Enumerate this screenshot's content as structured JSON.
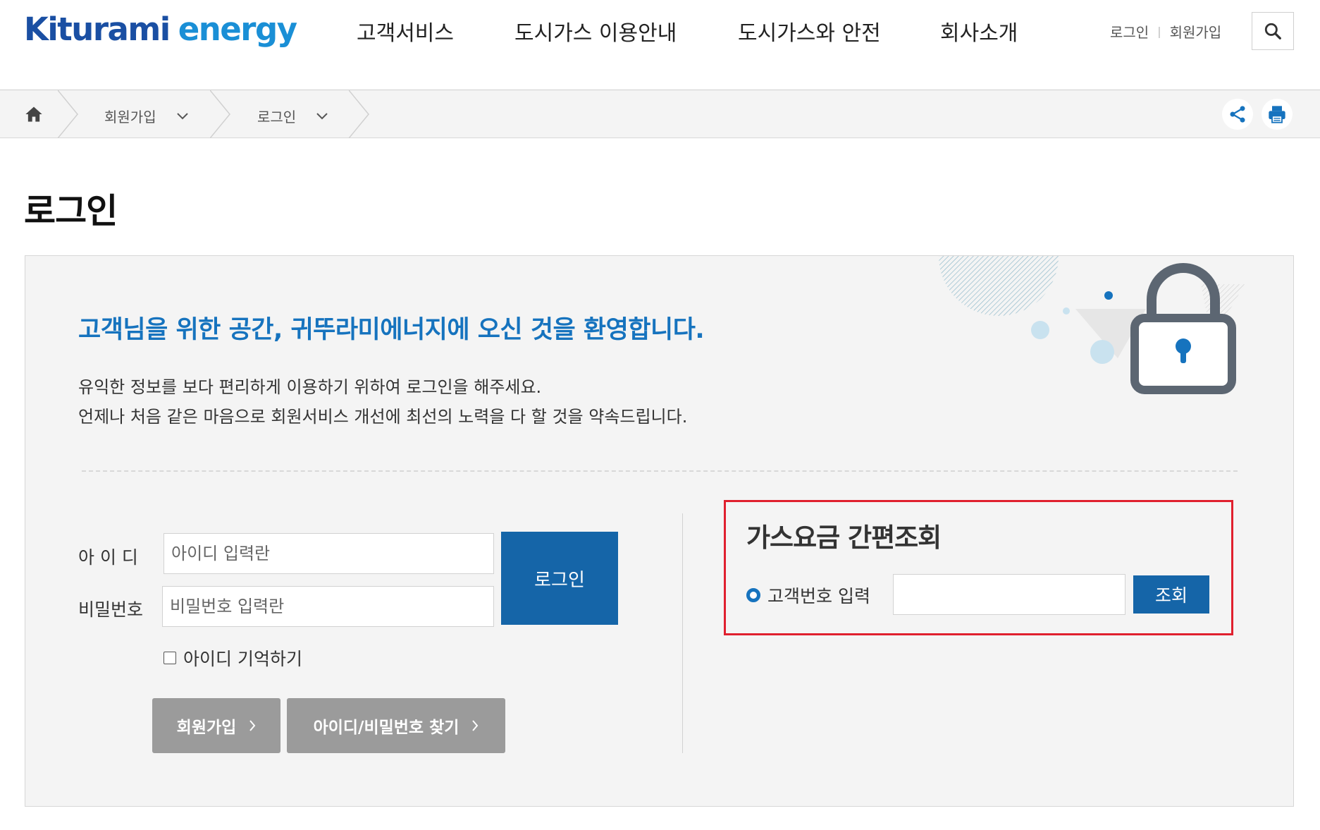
{
  "header": {
    "logo_brand": "Kiturami",
    "logo_sub": "energy",
    "nav": [
      "고객서비스",
      "도시가스 이용안내",
      "도시가스와 안전",
      "회사소개"
    ],
    "util_login": "로그인",
    "util_join": "회원가입",
    "search_icon": "search-icon"
  },
  "breadcrumb": {
    "home_icon": "home-icon",
    "items": [
      "회원가입",
      "로그인"
    ]
  },
  "toolbar": {
    "share_icon": "share-icon",
    "print_icon": "print-icon"
  },
  "page": {
    "title": "로그인"
  },
  "login": {
    "welcome": "고객님을 위한 공간, 귀뚜라미에너지에 오신 것을 환영합니다.",
    "desc_line1": "유익한 정보를 보다 편리하게 이용하기 위하여 로그인을 해주세요.",
    "desc_line2": "언제나 처음 같은 마음으로 회원서비스 개선에 최선의 노력을 다 할 것을 약속드립니다.",
    "id_label": "아 이 디",
    "id_placeholder": "아이디 입력란",
    "pw_label": "비밀번호",
    "pw_placeholder": "비밀번호 입력란",
    "login_button": "로그인",
    "remember_label": "아이디 기억하기",
    "join_button": "회원가입",
    "find_button": "아이디/비밀번호 찾기"
  },
  "quick_lookup": {
    "title": "가스요금 간편조회",
    "radio_label": "고객번호 입력",
    "input_value": "",
    "button": "조회"
  },
  "colors": {
    "accent": "#1673be",
    "button_blue": "#1565a8",
    "highlight_border": "#e0202e",
    "gray_button": "#9b9b9b"
  }
}
